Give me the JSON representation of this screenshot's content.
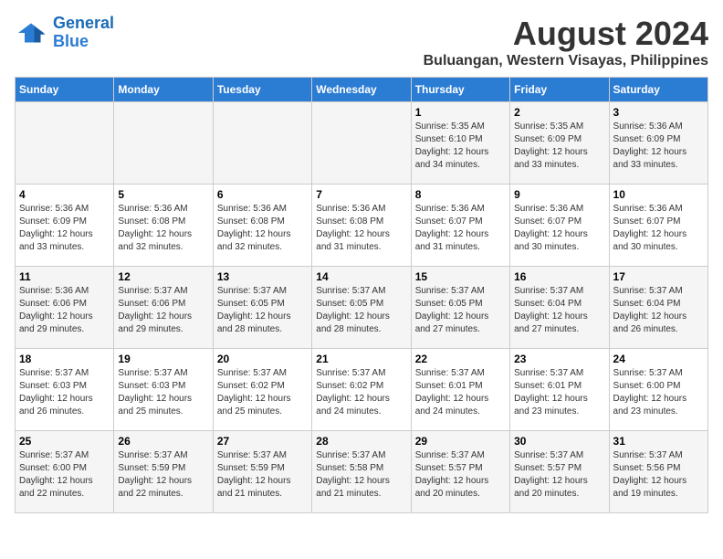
{
  "logo": {
    "line1": "General",
    "line2": "Blue"
  },
  "title": "August 2024",
  "subtitle": "Buluangan, Western Visayas, Philippines",
  "days_of_week": [
    "Sunday",
    "Monday",
    "Tuesday",
    "Wednesday",
    "Thursday",
    "Friday",
    "Saturday"
  ],
  "weeks": [
    [
      {
        "day": "",
        "info": ""
      },
      {
        "day": "",
        "info": ""
      },
      {
        "day": "",
        "info": ""
      },
      {
        "day": "",
        "info": ""
      },
      {
        "day": "1",
        "info": "Sunrise: 5:35 AM\nSunset: 6:10 PM\nDaylight: 12 hours\nand 34 minutes."
      },
      {
        "day": "2",
        "info": "Sunrise: 5:35 AM\nSunset: 6:09 PM\nDaylight: 12 hours\nand 33 minutes."
      },
      {
        "day": "3",
        "info": "Sunrise: 5:36 AM\nSunset: 6:09 PM\nDaylight: 12 hours\nand 33 minutes."
      }
    ],
    [
      {
        "day": "4",
        "info": "Sunrise: 5:36 AM\nSunset: 6:09 PM\nDaylight: 12 hours\nand 33 minutes."
      },
      {
        "day": "5",
        "info": "Sunrise: 5:36 AM\nSunset: 6:08 PM\nDaylight: 12 hours\nand 32 minutes."
      },
      {
        "day": "6",
        "info": "Sunrise: 5:36 AM\nSunset: 6:08 PM\nDaylight: 12 hours\nand 32 minutes."
      },
      {
        "day": "7",
        "info": "Sunrise: 5:36 AM\nSunset: 6:08 PM\nDaylight: 12 hours\nand 31 minutes."
      },
      {
        "day": "8",
        "info": "Sunrise: 5:36 AM\nSunset: 6:07 PM\nDaylight: 12 hours\nand 31 minutes."
      },
      {
        "day": "9",
        "info": "Sunrise: 5:36 AM\nSunset: 6:07 PM\nDaylight: 12 hours\nand 30 minutes."
      },
      {
        "day": "10",
        "info": "Sunrise: 5:36 AM\nSunset: 6:07 PM\nDaylight: 12 hours\nand 30 minutes."
      }
    ],
    [
      {
        "day": "11",
        "info": "Sunrise: 5:36 AM\nSunset: 6:06 PM\nDaylight: 12 hours\nand 29 minutes."
      },
      {
        "day": "12",
        "info": "Sunrise: 5:37 AM\nSunset: 6:06 PM\nDaylight: 12 hours\nand 29 minutes."
      },
      {
        "day": "13",
        "info": "Sunrise: 5:37 AM\nSunset: 6:05 PM\nDaylight: 12 hours\nand 28 minutes."
      },
      {
        "day": "14",
        "info": "Sunrise: 5:37 AM\nSunset: 6:05 PM\nDaylight: 12 hours\nand 28 minutes."
      },
      {
        "day": "15",
        "info": "Sunrise: 5:37 AM\nSunset: 6:05 PM\nDaylight: 12 hours\nand 27 minutes."
      },
      {
        "day": "16",
        "info": "Sunrise: 5:37 AM\nSunset: 6:04 PM\nDaylight: 12 hours\nand 27 minutes."
      },
      {
        "day": "17",
        "info": "Sunrise: 5:37 AM\nSunset: 6:04 PM\nDaylight: 12 hours\nand 26 minutes."
      }
    ],
    [
      {
        "day": "18",
        "info": "Sunrise: 5:37 AM\nSunset: 6:03 PM\nDaylight: 12 hours\nand 26 minutes."
      },
      {
        "day": "19",
        "info": "Sunrise: 5:37 AM\nSunset: 6:03 PM\nDaylight: 12 hours\nand 25 minutes."
      },
      {
        "day": "20",
        "info": "Sunrise: 5:37 AM\nSunset: 6:02 PM\nDaylight: 12 hours\nand 25 minutes."
      },
      {
        "day": "21",
        "info": "Sunrise: 5:37 AM\nSunset: 6:02 PM\nDaylight: 12 hours\nand 24 minutes."
      },
      {
        "day": "22",
        "info": "Sunrise: 5:37 AM\nSunset: 6:01 PM\nDaylight: 12 hours\nand 24 minutes."
      },
      {
        "day": "23",
        "info": "Sunrise: 5:37 AM\nSunset: 6:01 PM\nDaylight: 12 hours\nand 23 minutes."
      },
      {
        "day": "24",
        "info": "Sunrise: 5:37 AM\nSunset: 6:00 PM\nDaylight: 12 hours\nand 23 minutes."
      }
    ],
    [
      {
        "day": "25",
        "info": "Sunrise: 5:37 AM\nSunset: 6:00 PM\nDaylight: 12 hours\nand 22 minutes."
      },
      {
        "day": "26",
        "info": "Sunrise: 5:37 AM\nSunset: 5:59 PM\nDaylight: 12 hours\nand 22 minutes."
      },
      {
        "day": "27",
        "info": "Sunrise: 5:37 AM\nSunset: 5:59 PM\nDaylight: 12 hours\nand 21 minutes."
      },
      {
        "day": "28",
        "info": "Sunrise: 5:37 AM\nSunset: 5:58 PM\nDaylight: 12 hours\nand 21 minutes."
      },
      {
        "day": "29",
        "info": "Sunrise: 5:37 AM\nSunset: 5:57 PM\nDaylight: 12 hours\nand 20 minutes."
      },
      {
        "day": "30",
        "info": "Sunrise: 5:37 AM\nSunset: 5:57 PM\nDaylight: 12 hours\nand 20 minutes."
      },
      {
        "day": "31",
        "info": "Sunrise: 5:37 AM\nSunset: 5:56 PM\nDaylight: 12 hours\nand 19 minutes."
      }
    ]
  ]
}
